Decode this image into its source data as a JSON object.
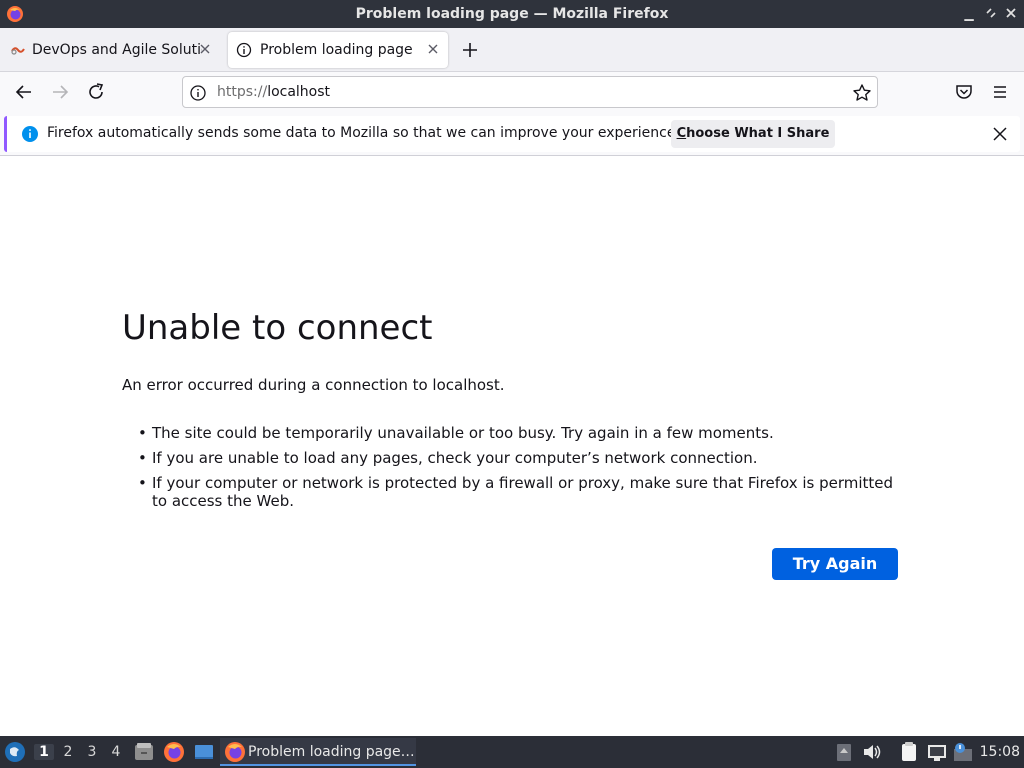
{
  "window": {
    "title": "Problem loading page — Mozilla Firefox"
  },
  "tabs": [
    {
      "label": "DevOps and Agile Solutio",
      "active": false
    },
    {
      "label": "Problem loading page",
      "active": true
    }
  ],
  "navbar": {
    "url_scheme": "https://",
    "url_host": "localhost"
  },
  "notification": {
    "message": "Firefox automatically sends some data to Mozilla so that we can improve your experience.",
    "button_first_letter": "C",
    "button_rest": "hoose What I Share"
  },
  "error_page": {
    "title": "Unable to connect",
    "lead": "An error occurred during a connection to localhost.",
    "bullets": [
      "The site could be temporarily unavailable or too busy. Try again in a few moments.",
      "If you are unable to load any pages, check your computer’s network connection.",
      "If your computer or network is protected by a firewall or proxy, make sure that Firefox is permitted to access the Web."
    ],
    "try_again_label": "Try Again"
  },
  "taskbar": {
    "workspaces": [
      "1",
      "2",
      "3",
      "4"
    ],
    "current_workspace": "1",
    "task_label": "Problem loading page…",
    "clock": "15:08"
  },
  "colors": {
    "accent_blue": "#0061e0",
    "notification_accent": "#9059ff",
    "info_blue": "#0090ed"
  }
}
